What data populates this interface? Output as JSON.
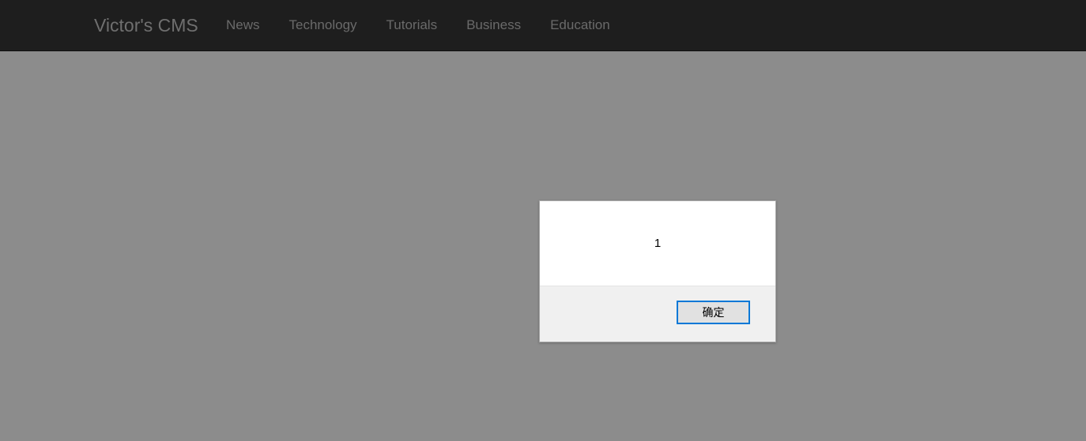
{
  "navbar": {
    "brand": "Victor's CMS",
    "items": [
      {
        "label": "News"
      },
      {
        "label": "Technology"
      },
      {
        "label": "Tutorials"
      },
      {
        "label": "Business"
      },
      {
        "label": "Education"
      }
    ]
  },
  "alert": {
    "message": "1",
    "ok_label": "确定"
  },
  "colors": {
    "navbar_bg": "#1e1e1e",
    "overlay_bg": "#8c8c8c",
    "button_focus_border": "#0078d7"
  }
}
